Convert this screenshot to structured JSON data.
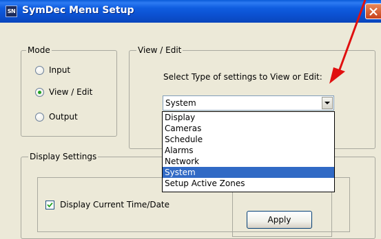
{
  "window": {
    "icon_text": "SN",
    "title": "SymDec Menu Setup"
  },
  "mode_group": {
    "label": "Mode",
    "options": [
      {
        "label": "Input",
        "checked": false
      },
      {
        "label": "View / Edit",
        "checked": true
      },
      {
        "label": "Output",
        "checked": false
      }
    ]
  },
  "view_edit_group": {
    "label": "View / Edit",
    "instruction": "Select Type of settings to View or Edit:",
    "select": {
      "value": "System",
      "options": [
        "Display",
        "Cameras",
        "Schedule",
        "Alarms",
        "Network",
        "System",
        "Setup Active Zones"
      ],
      "highlighted": "System"
    }
  },
  "display_group": {
    "label": "Display Settings",
    "checkbox_label": "Display Current Time/Date",
    "checkbox_checked": true,
    "apply_label": "Apply"
  },
  "colors": {
    "titlebar": "#0A5BD8",
    "selection": "#316AC5",
    "annotation_arrow": "#E01010",
    "dialog_bg": "#ECE9D8"
  }
}
